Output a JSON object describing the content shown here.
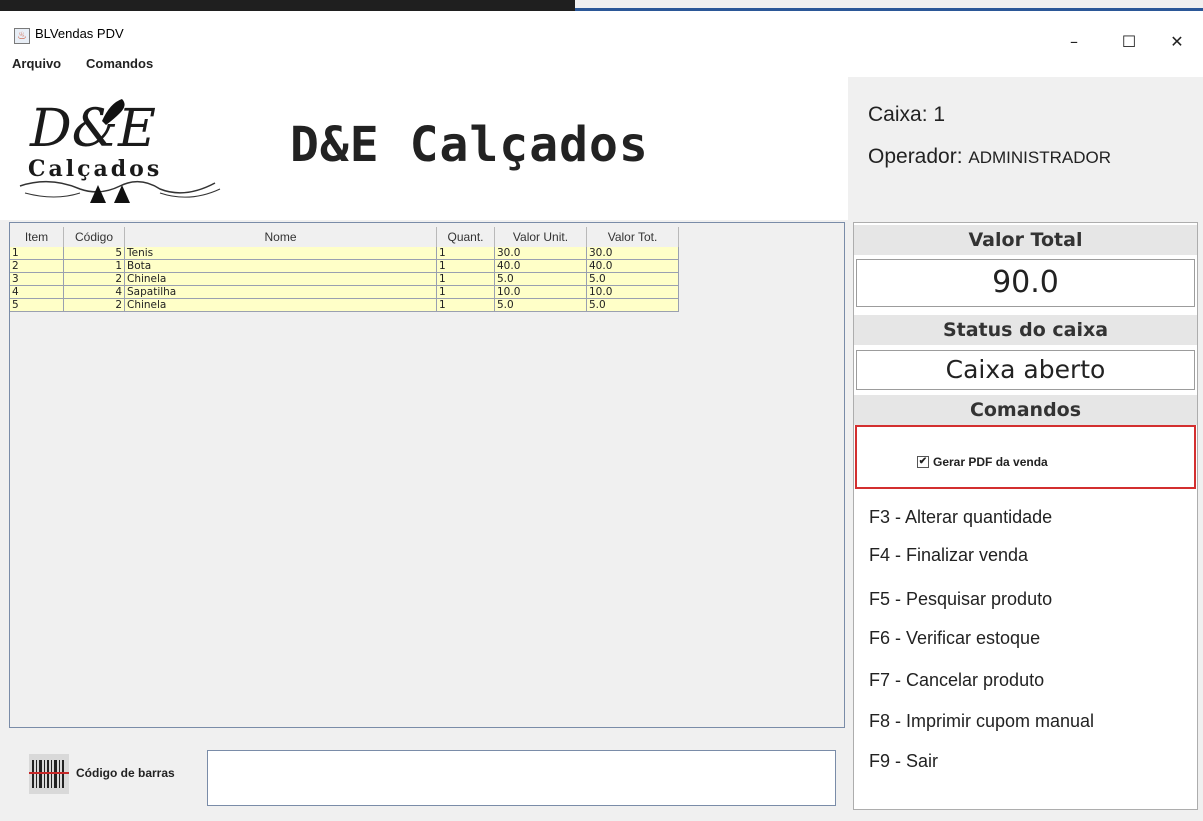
{
  "window": {
    "title": "BLVendas PDV",
    "minimize": "–",
    "maximize": "☐",
    "close": "✕"
  },
  "menu": [
    "Arquivo",
    "Comandos"
  ],
  "header": {
    "logo_text_top": "D&E",
    "logo_text_bottom": "Calçados",
    "store_name": "D&E Calçados"
  },
  "info": {
    "caixa_label": "Caixa: 1",
    "operador_prefix": "Operador: ",
    "operador_name": "ADMINISTRADOR"
  },
  "table": {
    "columns": [
      "Item",
      "Código",
      "Nome",
      "Quant.",
      "Valor Unit.",
      "Valor Tot."
    ],
    "rows": [
      [
        "1",
        "5",
        "Tenis",
        "1",
        "30.0",
        "30.0"
      ],
      [
        "2",
        "1",
        "Bota",
        "1",
        "40.0",
        "40.0"
      ],
      [
        "3",
        "2",
        "Chinela",
        "1",
        "5.0",
        "5.0"
      ],
      [
        "4",
        "4",
        "Sapatilha",
        "1",
        "10.0",
        "10.0"
      ],
      [
        "5",
        "2",
        "Chinela",
        "1",
        "5.0",
        "5.0"
      ]
    ]
  },
  "barcode": {
    "label": "Código de barras",
    "value": ""
  },
  "right": {
    "valor_total_title": "Valor Total",
    "valor_total": "90.0",
    "status_title": "Status do caixa",
    "status": "Caixa aberto",
    "comandos_title": "Comandos",
    "gerar_pdf_label": "Gerar PDF da venda",
    "gerar_pdf_checked": true,
    "commands": [
      "F3 - Alterar quantidade",
      "F4 - Finalizar venda",
      "F5 - Pesquisar produto",
      "F6 - Verificar estoque",
      "F7 - Cancelar produto",
      "F8 - Imprimir cupom manual",
      "F9 - Sair"
    ]
  },
  "colors": {
    "highlight_border": "#d32f2f",
    "table_row_bg": "#ffffc8"
  }
}
